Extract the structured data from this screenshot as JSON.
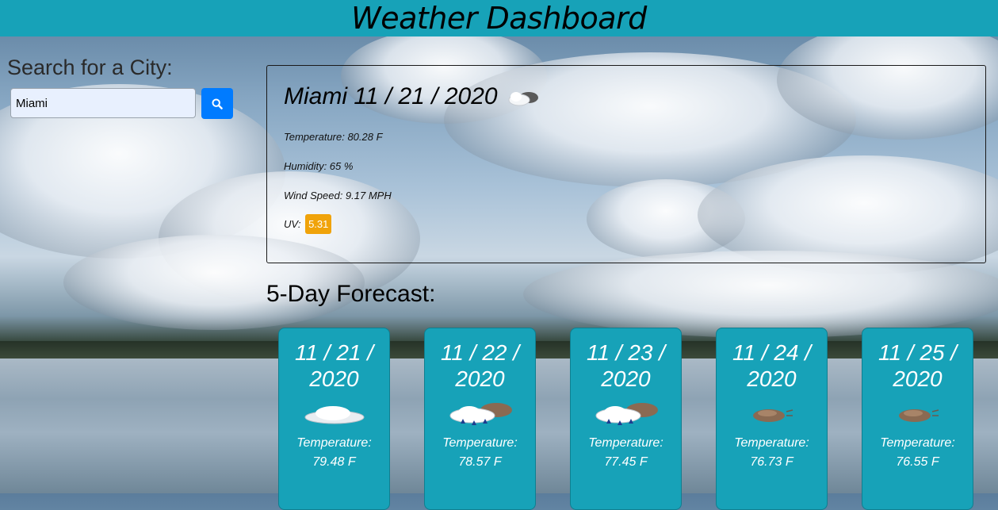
{
  "header": {
    "title": "Weather Dashboard"
  },
  "search": {
    "label": "Search for a City:",
    "value": "Miami",
    "button_icon": "search-icon"
  },
  "current": {
    "city": "Miami",
    "date": "11 / 21 / 2020",
    "icon": "partly-cloudy-icon",
    "temperature": "Temperature: 80.28 F",
    "humidity": "Humidity: 65 %",
    "wind": "Wind Speed: 9.17 MPH",
    "uv_label": "UV:",
    "uv_value": "5.31",
    "uv_color": "#f0a30a"
  },
  "forecast": {
    "heading": "5-Day Forecast:",
    "days": [
      {
        "date_line1": "11 / 21 /",
        "date_line2": "2020",
        "icon": "cloud-icon",
        "temp_label": "Temperature:",
        "temp": "79.48 F"
      },
      {
        "date_line1": "11 / 22 /",
        "date_line2": "2020",
        "icon": "rain-cloud-icon",
        "temp_label": "Temperature:",
        "temp": "78.57 F"
      },
      {
        "date_line1": "11 / 23 /",
        "date_line2": "2020",
        "icon": "rain-cloud-icon",
        "temp_label": "Temperature:",
        "temp": "77.45 F"
      },
      {
        "date_line1": "11 / 24 /",
        "date_line2": "2020",
        "icon": "windy-cloud-icon",
        "temp_label": "Temperature:",
        "temp": "76.73 F"
      },
      {
        "date_line1": "11 / 25 /",
        "date_line2": "2020",
        "icon": "windy-cloud-icon",
        "temp_label": "Temperature:",
        "temp": "76.55 F"
      }
    ]
  },
  "colors": {
    "header": "#17a2b8",
    "search_button": "#007bff",
    "card": "#17a2b8"
  }
}
